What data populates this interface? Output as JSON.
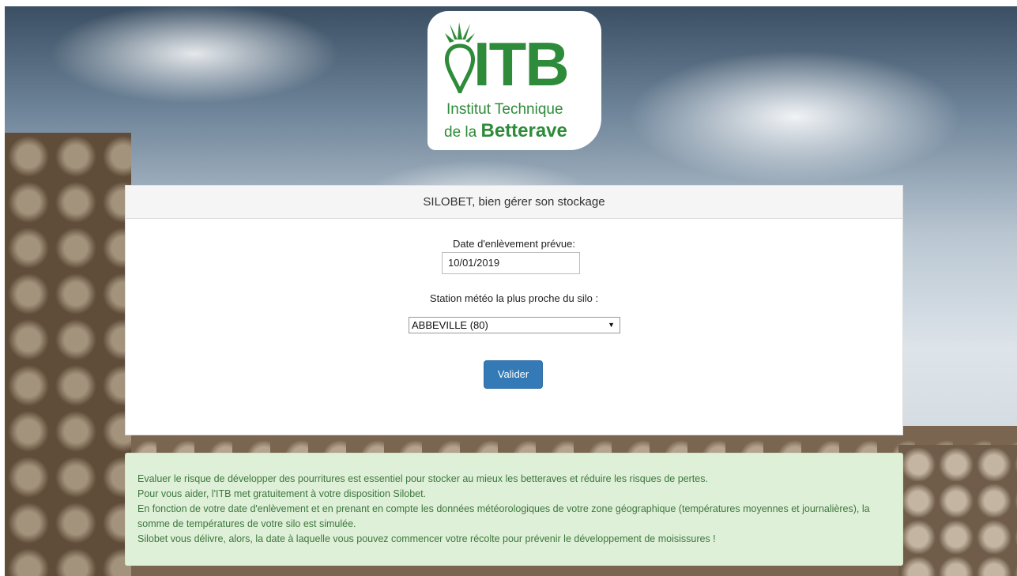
{
  "logo": {
    "brand": "ITB",
    "line1": "Institut Technique",
    "line2_prefix": "de la",
    "line2_bold": "Betterave",
    "color": "#2e8b3a"
  },
  "panel": {
    "title": "SILOBET, bien gérer son stockage",
    "date_label": "Date d'enlèvement prévue:",
    "date_value": "10/01/2019",
    "station_label": "Station météo la plus proche du silo :",
    "station_selected": "ABBEVILLE (80)",
    "submit_label": "Valider",
    "accent": "#337ab7"
  },
  "info": {
    "lines": [
      "Evaluer le risque de développer des pourritures est essentiel pour stocker au mieux les betteraves et réduire les risques de pertes.",
      "Pour vous aider, l'ITB met gratuitement à votre disposition Silobet.",
      "En fonction de votre date d'enlèvement et en prenant en compte les données météorologiques de votre zone géographique (températures moyennes et journalières), la somme de températures de votre silo est simulée.",
      "Silobet vous délivre, alors, la date à laquelle vous pouvez commencer votre récolte pour prévenir le développement de moisissures !"
    ]
  }
}
